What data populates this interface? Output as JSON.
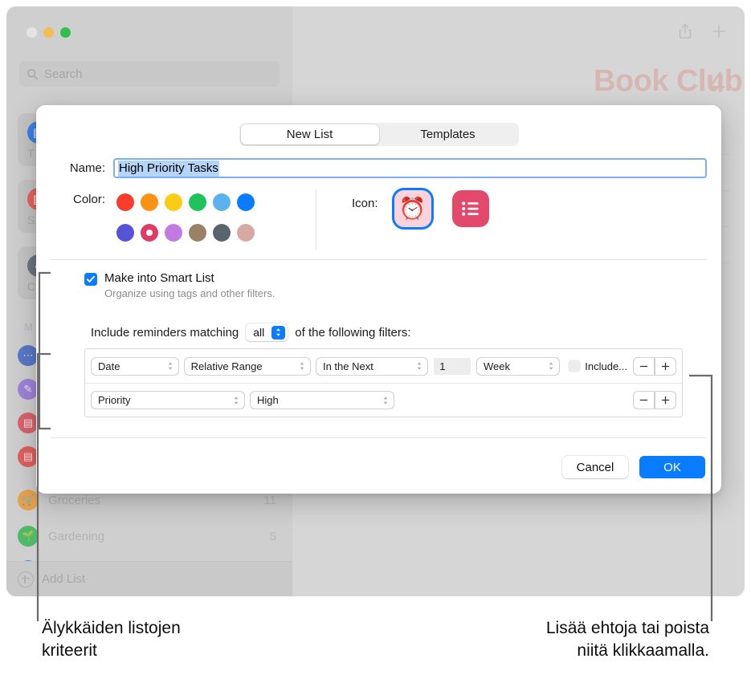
{
  "background_app": {
    "window_controls": [
      "close",
      "minimize",
      "maximize"
    ],
    "search": {
      "placeholder": "Search",
      "value": ""
    },
    "content": {
      "title": "Book Club",
      "count": "4",
      "share_icon": "share-icon",
      "add_icon": "plus-icon"
    },
    "smart_tiles": [
      {
        "label": "T",
        "color": "#3d81e8",
        "glyph": "▤"
      },
      {
        "label": "S",
        "color": "#e8635e",
        "glyph": "▤"
      },
      {
        "label": "C",
        "color": "#6c7480",
        "glyph": "✓"
      }
    ],
    "section_header": "M",
    "lists": [
      {
        "name": "",
        "count": "",
        "color": "#5878c8",
        "glyph": "⋯"
      },
      {
        "name": "",
        "count": "",
        "color": "#a083d8",
        "glyph": "✎"
      },
      {
        "name": "",
        "count": "",
        "color": "#d8646c",
        "glyph": "▤"
      },
      {
        "name": "",
        "count": "",
        "color": "#e06060",
        "glyph": "▤"
      },
      {
        "name": "Groceries",
        "count": "11",
        "color": "#e5a34f",
        "glyph": "🛒"
      },
      {
        "name": "Gardening",
        "count": "5",
        "color": "#4fb86b",
        "glyph": "🌱"
      },
      {
        "name": "",
        "count": "",
        "color": "#4d86e0",
        "glyph": "▤"
      }
    ],
    "add_list_label": "Add List"
  },
  "dialog": {
    "segmented": {
      "tabs": [
        {
          "label": "New List",
          "selected": true
        },
        {
          "label": "Templates",
          "selected": false
        }
      ]
    },
    "name": {
      "label": "Name:",
      "value": "High Priority Tasks",
      "selected": true
    },
    "color": {
      "label": "Color:",
      "swatches": [
        {
          "hex": "#fa3c2d",
          "selected": false
        },
        {
          "hex": "#fb9214",
          "selected": false
        },
        {
          "hex": "#fbcc15",
          "selected": false
        },
        {
          "hex": "#1ec459",
          "selected": false
        },
        {
          "hex": "#5ab2ef",
          "selected": false
        },
        {
          "hex": "#0a7cff",
          "selected": false
        },
        {
          "hex": "#5653d8",
          "selected": false
        },
        {
          "hex": "#e03b66",
          "selected": true
        },
        {
          "hex": "#c07ae0",
          "selected": false
        },
        {
          "hex": "#9b8166",
          "selected": false
        },
        {
          "hex": "#5a646e",
          "selected": false
        },
        {
          "hex": "#d6a9a3",
          "selected": false
        }
      ]
    },
    "icon": {
      "label": "Icon:",
      "options": [
        {
          "name": "alarm-clock-emoji-icon",
          "glyph": "⏰",
          "selected": true
        },
        {
          "name": "bulleted-list-icon",
          "glyph": "list",
          "selected": false
        }
      ]
    },
    "smart_list": {
      "checked": true,
      "title": "Make into Smart List",
      "subtitle": "Organize using tags and other filters."
    },
    "matching": {
      "prefix": "Include reminders matching",
      "value": "all",
      "suffix": "of the following filters:"
    },
    "filters": [
      {
        "field": "Date",
        "operator": "Relative Range",
        "qualifier": "In the Next",
        "amount": "1",
        "unit": "Week",
        "include_checkbox": {
          "label": "Include...",
          "checked": false
        },
        "remove_label": "−",
        "add_label": "+"
      },
      {
        "field": "Priority",
        "operator": "High",
        "remove_label": "−",
        "add_label": "+"
      }
    ],
    "buttons": {
      "cancel": "Cancel",
      "ok": "OK"
    }
  },
  "callouts": {
    "left": "Älykkäiden listojen\nkriteerit",
    "left_line1": "Älykkäiden listojen",
    "left_line2": "kriteerit",
    "right_line1": "Lisää ehtoja tai poista",
    "right_line2": "niitä klikkaamalla."
  },
  "colors": {
    "accent": "#0a7cff",
    "selection": "#b4d4f8",
    "callout_line": "#6b6b6b"
  }
}
